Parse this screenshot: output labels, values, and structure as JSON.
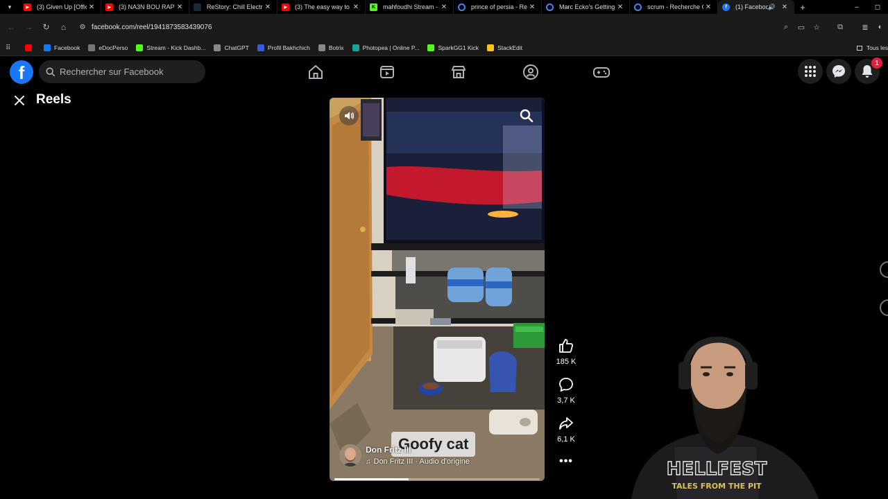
{
  "browser": {
    "tabs": [
      {
        "title": "(3) Given Up [Official",
        "favicon": "youtube",
        "color": "#ff0000",
        "active": false
      },
      {
        "title": "(3) NA3N BOU RAP -",
        "favicon": "youtube",
        "color": "#ff0000",
        "active": false
      },
      {
        "title": "ReStory: Chill Electron",
        "favicon": "steam",
        "color": "#1b2838",
        "active": false
      },
      {
        "title": "(3) The easy way to s",
        "favicon": "youtube",
        "color": "#ff0000",
        "active": false
      },
      {
        "title": "mahfoudhi Stream - V",
        "favicon": "kick",
        "color": "#53fc18",
        "active": false
      },
      {
        "title": "prince of persia - Rec",
        "favicon": "google",
        "color": "#ffffff",
        "active": false
      },
      {
        "title": "Marc Ecko's Getting",
        "favicon": "google",
        "color": "#ffffff",
        "active": false
      },
      {
        "title": "scrum - Recherche G",
        "favicon": "google",
        "color": "#ffffff",
        "active": false
      },
      {
        "title": "(1) Facebook",
        "favicon": "facebook",
        "color": "#1877f2",
        "active": true
      }
    ],
    "new_tab_label": "+",
    "url": "facebook.com/reel/1941873583439076",
    "bookmarks": [
      {
        "label": "",
        "color": "#ff0000"
      },
      {
        "label": "Facebook",
        "color": "#1877f2"
      },
      {
        "label": "eDocPerso",
        "color": "#777777"
      },
      {
        "label": "Stream - Kick Dashb...",
        "color": "#53fc18"
      },
      {
        "label": "ChatGPT",
        "color": "#888888"
      },
      {
        "label": "Profil Bakhchich",
        "color": "#3b5bdb"
      },
      {
        "label": "Botrix",
        "color": "#888888"
      },
      {
        "label": "Photopea | Online P...",
        "color": "#18a497"
      },
      {
        "label": "SparkGG1 Kick",
        "color": "#53fc18"
      },
      {
        "label": "StackEdit",
        "color": "#f5c518"
      }
    ],
    "bookmarks_folder": "Tous les"
  },
  "facebook": {
    "search_placeholder": "Rechercher sur Facebook",
    "nav_icons": [
      "home-icon",
      "video-icon",
      "marketplace-icon",
      "groups-icon",
      "gaming-icon"
    ],
    "notification_count": "1"
  },
  "reels": {
    "title": "Reels",
    "caption": "Goofy cat",
    "author": "Don Fritz III",
    "audio": "Don Fritz III · Audio d'origine",
    "progress": 0.36,
    "likes": "185 K",
    "comments": "3,7 K",
    "shares": "6,1 K",
    "more_label": "•••"
  }
}
